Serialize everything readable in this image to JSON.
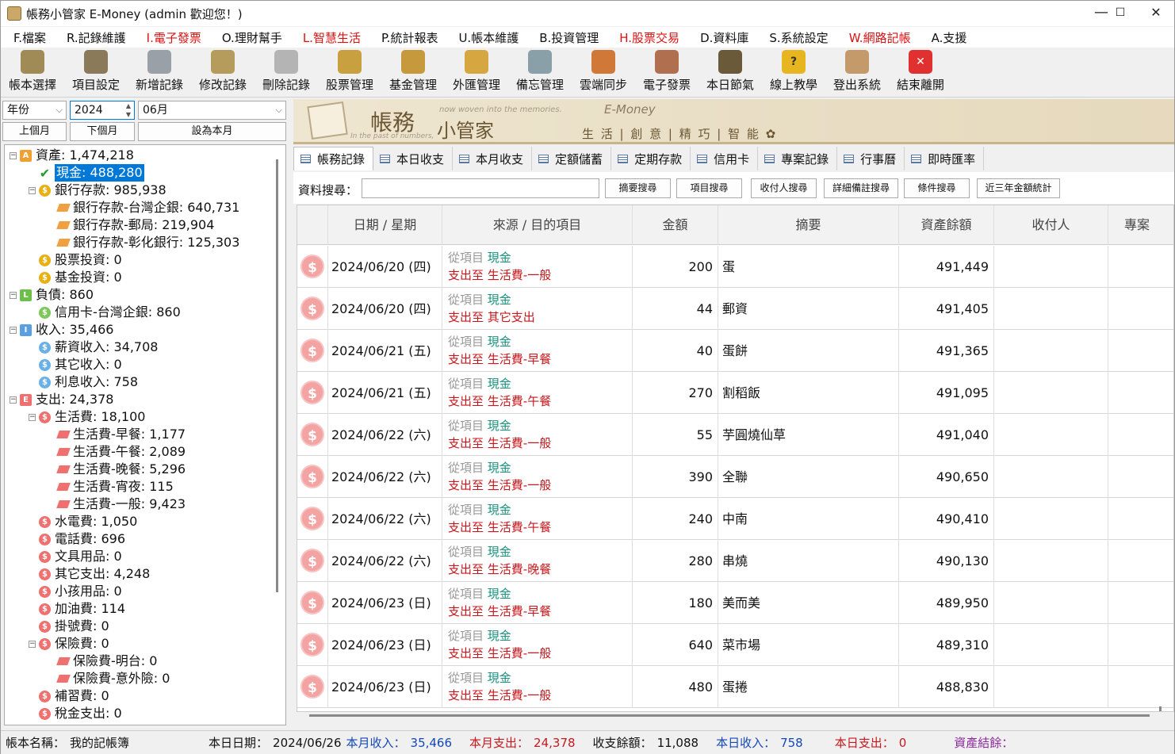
{
  "window": {
    "title": "帳務小管家 E-Money (admin 歡迎您！)",
    "min": "—",
    "max": "☐",
    "close": "✕"
  },
  "menu": [
    "F.檔案",
    "R.記錄維護",
    "I.電子發票",
    "O.理財幫手",
    "L.智慧生活",
    "P.統計報表",
    "U.帳本維護",
    "B.投資管理",
    "H.股票交易",
    "D.資料庫",
    "S.系統設定",
    "W.網路記帳",
    "A.支援"
  ],
  "menu_red": [
    2,
    4,
    8,
    11
  ],
  "toolbar": [
    {
      "label": "帳本選擇",
      "icon": "ledger-icon",
      "color": "#a08a55"
    },
    {
      "label": "項目設定",
      "icon": "settings-icon",
      "color": "#8a7a5a"
    },
    {
      "label": "新增記錄",
      "icon": "add-record-icon",
      "color": "#9aa0a8"
    },
    {
      "label": "修改記錄",
      "icon": "edit-record-icon",
      "color": "#b59c5c"
    },
    {
      "label": "刪除記錄",
      "icon": "delete-record-icon",
      "color": "#b4b4b4"
    },
    {
      "label": "股票管理",
      "icon": "stock-icon",
      "color": "#c9a040"
    },
    {
      "label": "基金管理",
      "icon": "fund-icon",
      "color": "#c69a3c"
    },
    {
      "label": "外匯管理",
      "icon": "forex-icon",
      "color": "#d6a640"
    },
    {
      "label": "備忘管理",
      "icon": "memo-icon",
      "color": "#8aa0a8"
    },
    {
      "label": "雲端同步",
      "icon": "cloud-sync-icon",
      "color": "#d07838"
    },
    {
      "label": "電子發票",
      "icon": "qr-invoice-icon",
      "color": "#b07050"
    },
    {
      "label": "本日節氣",
      "icon": "solar-term-icon",
      "color": "#6a5a3a"
    },
    {
      "label": "線上教學",
      "icon": "help-icon",
      "color": "#e6b520"
    },
    {
      "label": "登出系統",
      "icon": "logout-icon",
      "color": "#c49a6a"
    },
    {
      "label": "結束離開",
      "icon": "exit-icon",
      "color": "#e03030"
    }
  ],
  "filter": {
    "period": "年份",
    "year": "2024",
    "month": "06月",
    "prev": "上個月",
    "next": "下個月",
    "this_month": "設為本月"
  },
  "tree": [
    {
      "lv": 0,
      "tog": "⊟",
      "ic": "A",
      "icc": "#f0a030",
      "sq": true,
      "text": "資產: 1,474,218"
    },
    {
      "lv": 1,
      "tog": "",
      "ic": "✔",
      "icc": "check",
      "text": "現金: 488,280",
      "sel": true
    },
    {
      "lv": 1,
      "tog": "⊟",
      "ic": "$",
      "icc": "#e8b010",
      "text": "銀行存款: 985,938"
    },
    {
      "lv": 2,
      "tog": "",
      "ic": "",
      "icc": "#f0a040",
      "tag": true,
      "text": "銀行存款-台灣企銀: 640,731"
    },
    {
      "lv": 2,
      "tog": "",
      "ic": "",
      "icc": "#f0a040",
      "tag": true,
      "text": "銀行存款-郵局: 219,904"
    },
    {
      "lv": 2,
      "tog": "",
      "ic": "",
      "icc": "#f0a040",
      "tag": true,
      "text": "銀行存款-彰化銀行: 125,303"
    },
    {
      "lv": 1,
      "tog": "",
      "ic": "$",
      "icc": "#e8b010",
      "text": "股票投資: 0"
    },
    {
      "lv": 1,
      "tog": "",
      "ic": "$",
      "icc": "#e8b010",
      "text": "基金投資: 0"
    },
    {
      "lv": 0,
      "tog": "⊟",
      "ic": "L",
      "icc": "#6cbf4a",
      "sq": true,
      "text": "負債: 860"
    },
    {
      "lv": 1,
      "tog": "",
      "ic": "$",
      "icc": "#7dc85a",
      "text": "信用卡-台灣企銀: 860"
    },
    {
      "lv": 0,
      "tog": "⊟",
      "ic": "I",
      "icc": "#5aa0e0",
      "sq": true,
      "text": "收入: 35,466"
    },
    {
      "lv": 1,
      "tog": "",
      "ic": "$",
      "icc": "#6ab0e8",
      "text": "薪資收入: 34,708"
    },
    {
      "lv": 1,
      "tog": "",
      "ic": "$",
      "icc": "#6ab0e8",
      "text": "其它收入: 0"
    },
    {
      "lv": 1,
      "tog": "",
      "ic": "$",
      "icc": "#6ab0e8",
      "text": "利息收入: 758"
    },
    {
      "lv": 0,
      "tog": "⊟",
      "ic": "E",
      "icc": "#f07070",
      "sq": true,
      "text": "支出: 24,378"
    },
    {
      "lv": 1,
      "tog": "⊟",
      "ic": "$",
      "icc": "#f07070",
      "text": "生活費: 18,100"
    },
    {
      "lv": 2,
      "tog": "",
      "ic": "",
      "icc": "#f07070",
      "tag": true,
      "text": "生活費-早餐: 1,177"
    },
    {
      "lv": 2,
      "tog": "",
      "ic": "",
      "icc": "#f07070",
      "tag": true,
      "text": "生活費-午餐: 2,089"
    },
    {
      "lv": 2,
      "tog": "",
      "ic": "",
      "icc": "#f07070",
      "tag": true,
      "text": "生活費-晚餐: 5,296"
    },
    {
      "lv": 2,
      "tog": "",
      "ic": "",
      "icc": "#f07070",
      "tag": true,
      "text": "生活費-宵夜: 115"
    },
    {
      "lv": 2,
      "tog": "",
      "ic": "",
      "icc": "#f07070",
      "tag": true,
      "text": "生活費-一般: 9,423"
    },
    {
      "lv": 1,
      "tog": "",
      "ic": "$",
      "icc": "#f07070",
      "text": "水電費: 1,050"
    },
    {
      "lv": 1,
      "tog": "",
      "ic": "$",
      "icc": "#f07070",
      "text": "電話費: 696"
    },
    {
      "lv": 1,
      "tog": "",
      "ic": "$",
      "icc": "#f07070",
      "text": "文具用品: 0"
    },
    {
      "lv": 1,
      "tog": "",
      "ic": "$",
      "icc": "#f07070",
      "text": "其它支出: 4,248"
    },
    {
      "lv": 1,
      "tog": "",
      "ic": "$",
      "icc": "#f07070",
      "text": "小孩用品: 0"
    },
    {
      "lv": 1,
      "tog": "",
      "ic": "$",
      "icc": "#f07070",
      "text": "加油費: 114"
    },
    {
      "lv": 1,
      "tog": "",
      "ic": "$",
      "icc": "#f07070",
      "text": "掛號費: 0"
    },
    {
      "lv": 1,
      "tog": "⊟",
      "ic": "$",
      "icc": "#f07070",
      "text": "保險費: 0"
    },
    {
      "lv": 2,
      "tog": "",
      "ic": "",
      "icc": "#f07070",
      "tag": true,
      "text": "保險費-明台: 0"
    },
    {
      "lv": 2,
      "tog": "",
      "ic": "",
      "icc": "#f07070",
      "tag": true,
      "text": "保險費-意外險: 0"
    },
    {
      "lv": 1,
      "tog": "",
      "ic": "$",
      "icc": "#f07070",
      "text": "補習費: 0"
    },
    {
      "lv": 1,
      "tog": "",
      "ic": "$",
      "icc": "#f07070",
      "text": "稅金支出: 0"
    }
  ],
  "banner": {
    "logo1": "帳務",
    "logo2": "小管家",
    "sub1": "now woven into the memories.",
    "sub2": "In the past of numbers,",
    "brand": "E-Money",
    "slogan": "生 活 | 創 意 | 精 巧 | 智 能 ✿"
  },
  "tabs": [
    "帳務記錄",
    "本日收支",
    "本月收支",
    "定額儲蓄",
    "定期存款",
    "信用卡",
    "專案記錄",
    "行事曆",
    "即時匯率"
  ],
  "search": {
    "label": "資料搜尋：",
    "value": "",
    "buttons": [
      "摘要搜尋",
      "項目搜尋",
      "收付人搜尋",
      "詳細備註搜尋",
      "條件搜尋",
      "近三年金額統計"
    ]
  },
  "columns": [
    "",
    "日期 / 星期",
    "來源 / 目的項目",
    "金額",
    "摘要",
    "資產餘額",
    "收付人",
    "專案"
  ],
  "rows": [
    {
      "date": "2024/06/20 (四)",
      "from_lbl": "從項目",
      "from": "現金",
      "to_lbl": "支出至",
      "to": "生活費-一般",
      "amount": "200",
      "memo": "蛋",
      "balance": "491,449"
    },
    {
      "date": "2024/06/20 (四)",
      "from_lbl": "從項目",
      "from": "現金",
      "to_lbl": "支出至",
      "to": "其它支出",
      "amount": "44",
      "memo": "郵資",
      "balance": "491,405"
    },
    {
      "date": "2024/06/21 (五)",
      "from_lbl": "從項目",
      "from": "現金",
      "to_lbl": "支出至",
      "to": "生活費-早餐",
      "amount": "40",
      "memo": "蛋餅",
      "balance": "491,365"
    },
    {
      "date": "2024/06/21 (五)",
      "from_lbl": "從項目",
      "from": "現金",
      "to_lbl": "支出至",
      "to": "生活費-午餐",
      "amount": "270",
      "memo": "割稻飯",
      "balance": "491,095"
    },
    {
      "date": "2024/06/22 (六)",
      "from_lbl": "從項目",
      "from": "現金",
      "to_lbl": "支出至",
      "to": "生活費-一般",
      "amount": "55",
      "memo": "芋圓燒仙草",
      "balance": "491,040"
    },
    {
      "date": "2024/06/22 (六)",
      "from_lbl": "從項目",
      "from": "現金",
      "to_lbl": "支出至",
      "to": "生活費-一般",
      "amount": "390",
      "memo": "全聯",
      "balance": "490,650"
    },
    {
      "date": "2024/06/22 (六)",
      "from_lbl": "從項目",
      "from": "現金",
      "to_lbl": "支出至",
      "to": "生活費-午餐",
      "amount": "240",
      "memo": "中南",
      "balance": "490,410"
    },
    {
      "date": "2024/06/22 (六)",
      "from_lbl": "從項目",
      "from": "現金",
      "to_lbl": "支出至",
      "to": "生活費-晚餐",
      "amount": "280",
      "memo": "串燒",
      "balance": "490,130"
    },
    {
      "date": "2024/06/23 (日)",
      "from_lbl": "從項目",
      "from": "現金",
      "to_lbl": "支出至",
      "to": "生活費-早餐",
      "amount": "180",
      "memo": "美而美",
      "balance": "489,950"
    },
    {
      "date": "2024/06/23 (日)",
      "from_lbl": "從項目",
      "from": "現金",
      "to_lbl": "支出至",
      "to": "生活費-一般",
      "amount": "640",
      "memo": "菜市場",
      "balance": "489,310"
    },
    {
      "date": "2024/06/23 (日)",
      "from_lbl": "從項目",
      "from": "現金",
      "to_lbl": "支出至",
      "to": "生活費-一般",
      "amount": "480",
      "memo": "蛋捲",
      "balance": "488,830"
    }
  ],
  "status": {
    "book_lbl": "帳本名稱：",
    "book": "我的記帳簿",
    "date_lbl": "本日日期：",
    "date": "2024/06/26",
    "minc_lbl": "本月收入：",
    "minc": "35,466",
    "mexp_lbl": "本月支出：",
    "mexp": "24,378",
    "bal_lbl": "收支餘額：",
    "bal": "11,088",
    "dinc_lbl": "本日收入：",
    "dinc": "758",
    "dexp_lbl": "本日支出：",
    "dexp": "0",
    "asset_lbl": "資產結餘："
  }
}
